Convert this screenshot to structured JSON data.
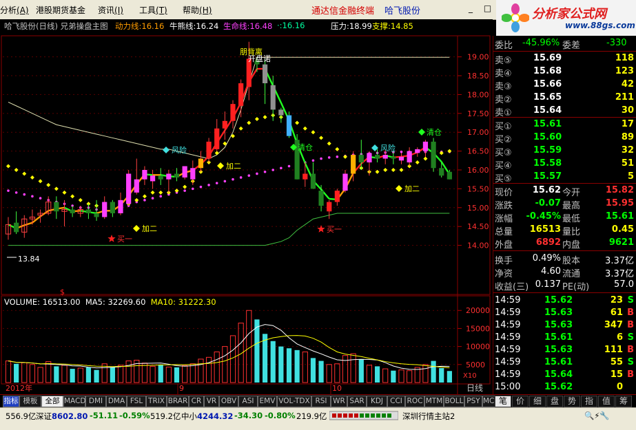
{
  "menu": {
    "items": [
      {
        "label": "分析",
        "key": "(A)"
      },
      {
        "label": "港股期货基金",
        "key": ""
      },
      {
        "label": "资讯",
        "key": "(I)"
      },
      {
        "label": "工具",
        "key": "(T)"
      },
      {
        "label": "帮助",
        "key": "(H)"
      }
    ],
    "center_title": "通达信金融终端",
    "center_stock": "哈飞股份",
    "window_buttons": "_ □ ×",
    "logo_title": "分析家公式网",
    "logo_url": "www.88gs.com"
  },
  "chart": {
    "title": "哈飞股份(日线) 兄弟操盘主图",
    "indicators": [
      {
        "label": "动力线:",
        "value": "16.16",
        "color": "#ff9c00"
      },
      {
        "label": "牛熊线:",
        "value": "16.24",
        "color": "#ffffff"
      },
      {
        "label": "生命线:",
        "value": "16.48",
        "color": "#ff40ff"
      },
      {
        "label": "·",
        "value": ":16.16",
        "color": "#00ffa0"
      },
      {
        "label": "压力:",
        "value": "18.99",
        "color": "#ffffff"
      },
      {
        "label": "支撑:",
        "value": "14.85",
        "color": "#ffff00"
      }
    ],
    "price_ticks": [
      "19.00",
      "18.50",
      "18.00",
      "17.50",
      "17.00",
      "16.50",
      "16.00",
      "15.50",
      "15.00",
      "14.50",
      "14.00"
    ],
    "volume_ticks": [
      "20000",
      "15000",
      "10000",
      "5000",
      "X10"
    ],
    "date_labels": [
      "2012年",
      "9",
      "10"
    ],
    "period_label": "日线",
    "low_marker": "13.84",
    "dollar_marker": "$",
    "annotations": {
      "buy": "买一",
      "add": "加二",
      "risk": "风险",
      "clear": "清仓",
      "top_text": "朋背离",
      "top_text2": "开盘诺"
    },
    "volume_info": [
      {
        "label": "VOLUME:",
        "value": "16513.00",
        "color": "#ffffff"
      },
      {
        "label": "MA5:",
        "value": "32269.60",
        "color": "#ffffff"
      },
      {
        "label": "MA10:",
        "value": "31222.30",
        "color": "#ffff00"
      }
    ]
  },
  "chart_data": {
    "type": "candlestick",
    "ylim": [
      13.7,
      19.45
    ],
    "candles": [
      {
        "o": 14.3,
        "h": 14.75,
        "l": 14.15,
        "c": 14.55
      },
      {
        "o": 14.6,
        "h": 14.9,
        "l": 14.3,
        "c": 14.35
      },
      {
        "o": 14.35,
        "h": 14.8,
        "l": 14.2,
        "c": 14.7
      },
      {
        "o": 14.7,
        "h": 14.95,
        "l": 14.55,
        "c": 14.75
      },
      {
        "o": 14.8,
        "h": 14.95,
        "l": 14.6,
        "c": 14.85
      },
      {
        "o": 14.85,
        "h": 15.3,
        "l": 14.8,
        "c": 15.15
      },
      {
        "o": 15.15,
        "h": 15.3,
        "l": 14.7,
        "c": 14.9
      },
      {
        "o": 14.9,
        "h": 15.2,
        "l": 14.5,
        "c": 14.95
      },
      {
        "o": 14.95,
        "h": 15.05,
        "l": 14.75,
        "c": 14.85
      },
      {
        "o": 14.85,
        "h": 15.05,
        "l": 14.75,
        "c": 14.95
      },
      {
        "o": 14.95,
        "h": 15.1,
        "l": 14.7,
        "c": 14.85
      },
      {
        "o": 14.85,
        "h": 15.2,
        "l": 14.65,
        "c": 14.75
      },
      {
        "o": 14.75,
        "h": 15.3,
        "l": 14.7,
        "c": 15.15
      },
      {
        "o": 15.15,
        "h": 15.2,
        "l": 14.75,
        "c": 14.85
      },
      {
        "o": 14.85,
        "h": 15.4,
        "l": 14.8,
        "c": 15.2
      },
      {
        "o": 15.1,
        "h": 16.0,
        "l": 15.05,
        "c": 15.9
      },
      {
        "o": 15.4,
        "h": 16.3,
        "l": 15.35,
        "c": 15.75
      },
      {
        "o": 15.75,
        "h": 16.1,
        "l": 15.6,
        "c": 16.0
      },
      {
        "o": 15.7,
        "h": 16.0,
        "l": 15.5,
        "c": 15.85
      },
      {
        "o": 15.85,
        "h": 16.05,
        "l": 15.6,
        "c": 15.75
      },
      {
        "o": 15.75,
        "h": 16.0,
        "l": 15.4,
        "c": 15.9
      },
      {
        "o": 15.9,
        "h": 16.05,
        "l": 15.7,
        "c": 15.8
      },
      {
        "o": 15.8,
        "h": 16.1,
        "l": 15.75,
        "c": 16.1
      },
      {
        "o": 15.75,
        "h": 16.25,
        "l": 15.6,
        "c": 16.05
      },
      {
        "o": 16.05,
        "h": 16.5,
        "l": 15.95,
        "c": 16.3
      },
      {
        "o": 16.3,
        "h": 16.85,
        "l": 16.2,
        "c": 16.75
      },
      {
        "o": 16.55,
        "h": 17.35,
        "l": 16.5,
        "c": 17.1
      },
      {
        "o": 17.1,
        "h": 17.55,
        "l": 16.8,
        "c": 17.3
      },
      {
        "o": 17.3,
        "h": 17.85,
        "l": 17.1,
        "c": 17.75
      },
      {
        "o": 17.7,
        "h": 18.4,
        "l": 17.4,
        "c": 18.3
      },
      {
        "o": 18.2,
        "h": 19.4,
        "l": 17.85,
        "c": 18.95
      },
      {
        "o": 18.9,
        "h": 19.0,
        "l": 18.6,
        "c": 18.8
      },
      {
        "o": 18.8,
        "h": 18.95,
        "l": 17.75,
        "c": 18.3
      },
      {
        "o": 18.25,
        "h": 18.5,
        "l": 17.3,
        "c": 17.6
      },
      {
        "o": 17.6,
        "h": 17.65,
        "l": 17.25,
        "c": 17.45
      },
      {
        "o": 17.45,
        "h": 17.55,
        "l": 16.85,
        "c": 16.9
      },
      {
        "o": 16.8,
        "h": 16.95,
        "l": 15.75,
        "c": 15.75
      },
      {
        "o": 15.75,
        "h": 16.2,
        "l": 15.55,
        "c": 15.9
      },
      {
        "o": 15.9,
        "h": 16.2,
        "l": 15.5,
        "c": 15.5
      },
      {
        "o": 15.45,
        "h": 15.6,
        "l": 14.9,
        "c": 15.05
      },
      {
        "o": 14.9,
        "h": 15.2,
        "l": 14.7,
        "c": 15.15
      },
      {
        "o": 15.15,
        "h": 15.5,
        "l": 15.05,
        "c": 15.45
      },
      {
        "o": 15.45,
        "h": 16.0,
        "l": 15.4,
        "c": 15.9
      },
      {
        "o": 15.9,
        "h": 16.5,
        "l": 15.7,
        "c": 16.4
      },
      {
        "o": 16.4,
        "h": 16.8,
        "l": 16.0,
        "c": 16.2
      },
      {
        "o": 16.2,
        "h": 16.5,
        "l": 15.85,
        "c": 16.45
      },
      {
        "o": 16.4,
        "h": 16.55,
        "l": 16.2,
        "c": 16.3
      },
      {
        "o": 16.3,
        "h": 16.55,
        "l": 16.15,
        "c": 16.4
      },
      {
        "o": 16.35,
        "h": 16.5,
        "l": 16.15,
        "c": 16.3
      },
      {
        "o": 16.25,
        "h": 16.45,
        "l": 16.15,
        "c": 16.35
      },
      {
        "o": 16.2,
        "h": 16.6,
        "l": 16.1,
        "c": 16.5
      },
      {
        "o": 16.45,
        "h": 16.6,
        "l": 16.35,
        "c": 16.55
      },
      {
        "o": 16.5,
        "h": 16.8,
        "l": 16.35,
        "c": 16.75
      },
      {
        "o": 16.75,
        "h": 16.85,
        "l": 15.95,
        "c": 16.05
      },
      {
        "o": 16.05,
        "h": 16.2,
        "l": 15.8,
        "c": 15.85
      },
      {
        "o": 15.95,
        "h": 16.0,
        "l": 15.75,
        "c": 15.75
      }
    ],
    "volumes": [
      6000,
      5200,
      5500,
      5000,
      4200,
      5800,
      4500,
      4800,
      3800,
      4000,
      4200,
      3500,
      5200,
      4200,
      4800,
      6000,
      6200,
      5400,
      4500,
      5000,
      4300,
      4200,
      4700,
      5200,
      6500,
      7000,
      8500,
      10000,
      13000,
      16500,
      20000,
      17500,
      13500,
      11500,
      10000,
      9500,
      9000,
      8500,
      6800,
      6000,
      5000,
      5200,
      7500,
      8000,
      6500,
      4800,
      4500,
      3800,
      3300,
      3500,
      3300,
      4200,
      5000,
      6000,
      4000,
      3200
    ],
    "vol_ylim": [
      0,
      21000
    ],
    "life_line": [
      15.45,
      15.4,
      15.35,
      15.3,
      15.25,
      15.2,
      15.15,
      15.1,
      15.05,
      15.0,
      15.0,
      14.95,
      14.95,
      14.95,
      15.0,
      15.05,
      15.15,
      15.2,
      15.25,
      15.3,
      15.35,
      15.4,
      15.45,
      15.5,
      15.55,
      15.6,
      15.65,
      15.7,
      15.75,
      15.8,
      15.85,
      15.9,
      15.95,
      16.0,
      16.05,
      16.1,
      16.15,
      16.2,
      16.25,
      16.3,
      16.33,
      16.35,
      16.37,
      16.4,
      16.42,
      16.44,
      16.45,
      16.46,
      16.47,
      16.48,
      16.48,
      16.48,
      16.48,
      16.48,
      16.48,
      16.48
    ],
    "support_dots": [
      16.1,
      16.0,
      15.9,
      15.8,
      15.7,
      15.6,
      15.5,
      15.4,
      15.3,
      15.2,
      15.1,
      15.05,
      15.0,
      15.0,
      15.05,
      15.1,
      15.2,
      15.3,
      15.4,
      15.4,
      15.4,
      15.45,
      15.55,
      15.7,
      15.95,
      16.2,
      16.45,
      16.7,
      16.9,
      17.1,
      17.25,
      17.35,
      17.4,
      17.45,
      17.4,
      17.35,
      17.25,
      17.1,
      17.0,
      16.85,
      16.7,
      16.55,
      16.35,
      16.2,
      16.05,
      15.95,
      15.95,
      16.0,
      16.0,
      16.0,
      16.1,
      16.2,
      16.3,
      16.4,
      16.45,
      16.5
    ],
    "bull_bear_line": [
      17.8,
      17.7,
      17.6,
      17.5,
      17.4,
      17.3,
      17.2,
      17.15,
      17.1,
      17.05,
      17.0,
      16.95,
      16.9,
      16.85,
      16.8,
      16.75,
      16.7,
      16.65,
      16.6,
      16.55,
      16.55,
      16.5,
      16.45,
      16.4,
      16.35,
      16.3,
      16.4,
      16.6,
      17.0,
      17.6,
      18.3,
      18.99,
      18.99,
      18.99,
      18.99,
      18.99,
      18.99,
      18.99,
      18.99,
      18.99,
      18.99,
      18.99,
      18.99,
      18.99,
      18.99,
      18.99,
      18.99,
      18.99,
      18.99,
      18.99,
      18.99,
      18.99,
      18.99,
      18.99,
      18.99,
      18.99
    ],
    "lower_band": [
      14.0,
      14.0,
      14.0,
      14.0,
      14.0,
      14.0,
      14.0,
      14.0,
      14.0,
      14.0,
      14.0,
      14.0,
      14.0,
      14.0,
      14.0,
      14.0,
      14.0,
      14.0,
      14.0,
      14.0,
      14.0,
      14.0,
      14.0,
      14.0,
      14.0,
      14.0,
      14.0,
      14.0,
      14.0,
      14.0,
      14.0,
      14.0,
      14.0,
      14.05,
      14.1,
      14.2,
      14.4,
      14.55,
      14.7,
      14.75,
      14.8,
      14.85,
      14.85,
      14.85,
      14.85,
      14.85,
      14.85,
      14.85,
      14.85,
      14.85,
      14.85,
      14.85,
      14.85,
      14.85,
      14.85,
      14.85
    ]
  },
  "quote": {
    "wei_bi_label": "委比",
    "wei_bi": "-45.96%",
    "wei_cha_label": "委差",
    "wei_cha": "-330",
    "sell": [
      {
        "label": "卖⑤",
        "price": "15.69",
        "vol": "118"
      },
      {
        "label": "卖④",
        "price": "15.68",
        "vol": "123"
      },
      {
        "label": "卖③",
        "price": "15.66",
        "vol": "42"
      },
      {
        "label": "卖②",
        "price": "15.65",
        "vol": "211"
      },
      {
        "label": "卖①",
        "price": "15.64",
        "vol": "30"
      }
    ],
    "buy": [
      {
        "label": "买①",
        "price": "15.61",
        "vol": "17"
      },
      {
        "label": "买②",
        "price": "15.60",
        "vol": "89"
      },
      {
        "label": "买③",
        "price": "15.59",
        "vol": "32"
      },
      {
        "label": "买④",
        "price": "15.58",
        "vol": "51"
      },
      {
        "label": "买⑤",
        "price": "15.57",
        "vol": "5"
      }
    ],
    "stats": [
      {
        "l1": "现价",
        "v1": "15.62",
        "c1": "#ffffff",
        "l2": "今开",
        "v2": "15.82",
        "c2": "#ff3030"
      },
      {
        "l1": "涨跌",
        "v1": "-0.07",
        "c1": "#00ff00",
        "l2": "最高",
        "v2": "15.95",
        "c2": "#ff3030"
      },
      {
        "l1": "涨幅",
        "v1": "-0.45%",
        "c1": "#00ff00",
        "l2": "最低",
        "v2": "15.61",
        "c2": "#00ff00"
      },
      {
        "l1": "总量",
        "v1": "16513",
        "c1": "#ffff00",
        "l2": "量比",
        "v2": "0.45",
        "c2": "#ffff00"
      },
      {
        "l1": "外盘",
        "v1": "6892",
        "c1": "#ff3030",
        "l2": "内盘",
        "v2": "9621",
        "c2": "#00ff00"
      }
    ],
    "fin": [
      {
        "l1": "换手",
        "v1": "0.49%",
        "l2": "股本",
        "v2": "3.37亿"
      },
      {
        "l1": "净资",
        "v1": "4.60",
        "l2": "流通",
        "v2": "3.37亿"
      },
      {
        "l1": "收益(三)",
        "v1": "0.137",
        "l2": "PE(动)",
        "v2": "57.0"
      }
    ],
    "ticks": [
      {
        "time": "14:59",
        "price": "15.62",
        "vol": "23",
        "dir": "S"
      },
      {
        "time": "14:59",
        "price": "15.63",
        "vol": "61",
        "dir": "B"
      },
      {
        "time": "14:59",
        "price": "15.63",
        "vol": "347",
        "dir": "B"
      },
      {
        "time": "14:59",
        "price": "15.61",
        "vol": "6",
        "dir": "S"
      },
      {
        "time": "14:59",
        "price": "15.63",
        "vol": "111",
        "dir": "B"
      },
      {
        "time": "14:59",
        "price": "15.61",
        "vol": "55",
        "dir": "S"
      },
      {
        "time": "14:59",
        "price": "15.64",
        "vol": "15",
        "dir": "B"
      },
      {
        "time": "15:00",
        "price": "15.62",
        "vol": "0",
        "dir": ""
      }
    ]
  },
  "tabs": [
    "指标",
    "模板",
    "全部",
    "MACD",
    "DMI",
    "DMA",
    "FSL",
    "TRIX",
    "BRAR",
    "CR",
    "VR",
    "OBV",
    "ASI",
    "EMV",
    "VOL-TDX",
    "RSI",
    "WR",
    "SAR",
    "KDJ",
    "CCI",
    "ROC",
    "MTM",
    "BOLL",
    "PSY",
    "MCST"
  ],
  "side_tabs": [
    "笔",
    "价",
    "细",
    "盘",
    "势",
    "指",
    "值",
    "筹"
  ],
  "status": {
    "s1": "556.9亿",
    "sz_label": "深证",
    "sz_val": "8602.80",
    "sz_chg": "-51.11",
    "sz_pct": "-0.59%",
    "sz_amt": "519.2亿",
    "zx_label": "中小",
    "zx_val": "4244.32",
    "zx_chg": "-34.30",
    "zx_pct": "-0.80%",
    "zx_amt": "219.9亿",
    "server": "深圳行情主站2"
  }
}
